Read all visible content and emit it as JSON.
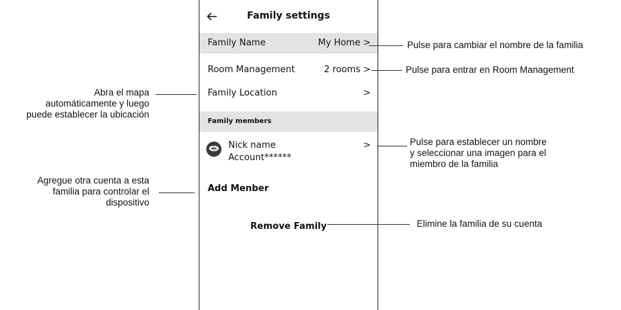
{
  "header": {
    "title": "Family settings",
    "back_icon": "arrow-left-icon"
  },
  "rows": {
    "family_name": {
      "label": "Family Name",
      "value": "My Home >"
    },
    "room_management": {
      "label": "Room Management",
      "value": "2 rooms >"
    },
    "family_location": {
      "label": "Family Location",
      "value": ">"
    }
  },
  "members_section": {
    "label": "Family members"
  },
  "member": {
    "nick": "Nick name",
    "account": "Account******",
    "chevron": ">"
  },
  "add_member": "Add Menber",
  "remove_family": "Remove Family",
  "annotations": {
    "family_name": "Pulse para cambiar el nombre de la familia",
    "room_management": "Pulse para entrar en Room Management",
    "location": [
      "Abra el mapa",
      "automáticamente y luego",
      "puede establecer la ubicación"
    ],
    "member": [
      "Pulse para establecer un nombre",
      "y seleccionar una imagen para el",
      "miembro de la familia"
    ],
    "add_member": [
      "Agregue otra cuenta a esta",
      "familia para controlar el",
      "dispositivo"
    ],
    "remove": "Elimine la familia de su cuenta"
  },
  "colors": {
    "shade": "#e3e3e3",
    "avatar": "#3b3b3b"
  }
}
